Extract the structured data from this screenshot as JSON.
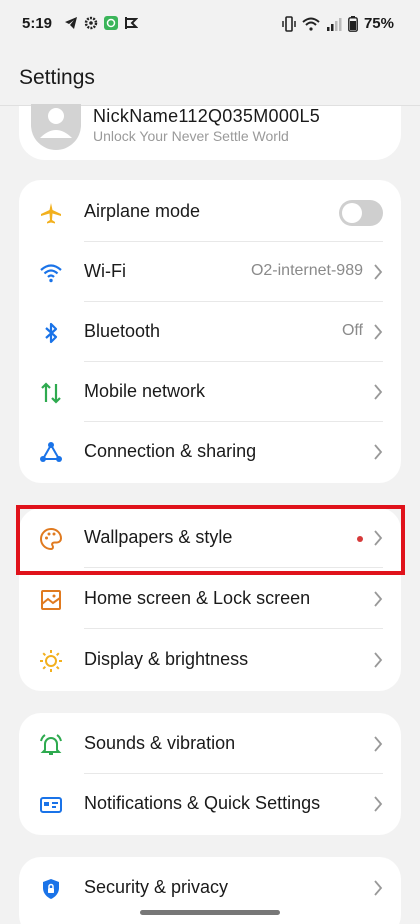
{
  "status_bar": {
    "time": "5:19",
    "battery": "75%"
  },
  "header": {
    "title": "Settings"
  },
  "profile": {
    "name": "NickName112Q035M000L5",
    "subtitle": "Unlock Your Never Settle World"
  },
  "connectivity": {
    "airplane": {
      "label": "Airplane mode",
      "toggle": "off"
    },
    "wifi": {
      "label": "Wi-Fi",
      "value": "O2-internet-989"
    },
    "bluetooth": {
      "label": "Bluetooth",
      "value": "Off"
    },
    "mobile": {
      "label": "Mobile network"
    },
    "connection": {
      "label": "Connection & sharing"
    }
  },
  "personalization": {
    "wallpapers": {
      "label": "Wallpapers & style"
    },
    "home": {
      "label": "Home screen & Lock screen"
    },
    "display": {
      "label": "Display & brightness"
    }
  },
  "sounds_group": {
    "sounds": {
      "label": "Sounds & vibration"
    },
    "notifications": {
      "label": "Notifications & Quick Settings"
    }
  },
  "security_group": {
    "security": {
      "label": "Security & privacy"
    }
  },
  "colors": {
    "accent_blue": "#1a73e8",
    "accent_orange": "#e07a1f",
    "accent_green": "#2eaa4f",
    "highlight_red": "#e0121b",
    "airplane_yellow": "#f2b01e"
  }
}
